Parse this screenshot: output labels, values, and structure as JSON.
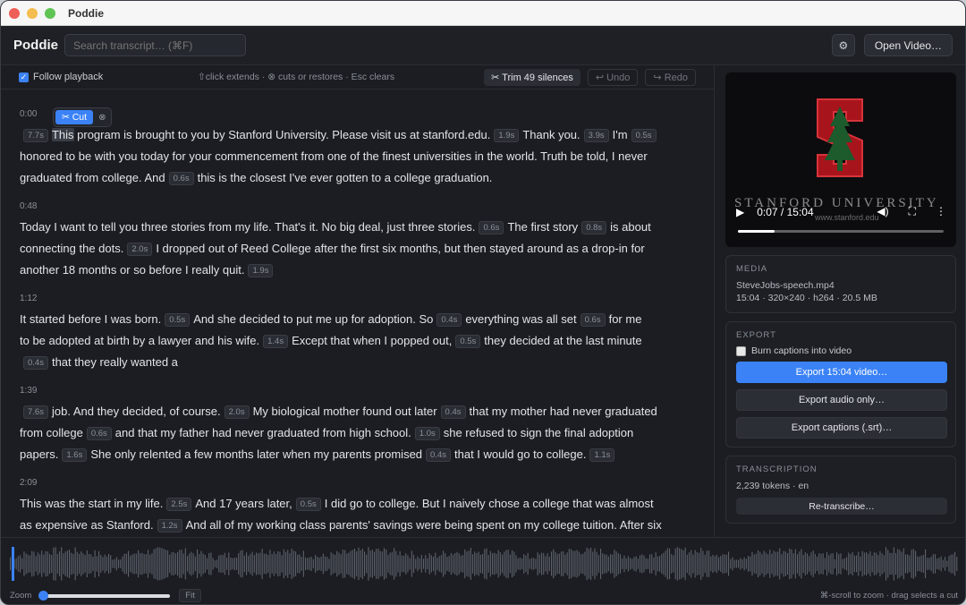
{
  "window": {
    "title": "Poddie"
  },
  "header": {
    "brand": "Poddie",
    "search_placeholder": "Search transcript… (⌘F)",
    "gear_glyph": "⚙",
    "open_video_label": "Open Video…"
  },
  "toolbar": {
    "follow_label": "Follow playback",
    "follow_checked": true,
    "hint": "⇧click extends · ⊗ cuts or restores · Esc clears",
    "trim_label": "✂ Trim 49 silences",
    "undo_label": "↩ Undo",
    "redo_label": "↪ Redo"
  },
  "cut_popup": {
    "cut_label": "✂ Cut",
    "restore_glyph": "⊗"
  },
  "transcript": [
    {
      "time": "0:00",
      "lines": [
        [
          {
            "s": "7.7s"
          },
          {
            "t": "This",
            "hl": true
          },
          {
            "t": " program is brought to you by Stanford University. Please visit us at stanford.edu."
          },
          {
            "s": "1.9s"
          },
          {
            "t": "Thank you."
          },
          {
            "s": "3.9s"
          },
          {
            "t": "I'm"
          },
          {
            "s": "0.5s"
          }
        ],
        [
          {
            "t": "honored to be with you today for your commencement from one of the finest universities in the world. Truth be told, I never"
          }
        ],
        [
          {
            "t": "graduated from college. And"
          },
          {
            "s": "0.6s"
          },
          {
            "t": "this is the closest I've ever gotten to a college graduation."
          }
        ]
      ]
    },
    {
      "time": "0:48",
      "lines": [
        [
          {
            "t": "Today I want to tell you three stories from my life. That's it. No big deal, just three stories."
          },
          {
            "s": "0.6s"
          },
          {
            "t": "The first story"
          },
          {
            "s": "0.8s"
          },
          {
            "t": "is about"
          }
        ],
        [
          {
            "t": "connecting the dots."
          },
          {
            "s": "2.0s"
          },
          {
            "t": "I dropped out of Reed College after the first six months, but then stayed around as a drop-in for"
          }
        ],
        [
          {
            "t": "another 18 months or so before I really quit."
          },
          {
            "s": "1.9s"
          }
        ]
      ]
    },
    {
      "time": "1:12",
      "lines": [
        [
          {
            "t": "It started before I was born."
          },
          {
            "s": "0.5s"
          },
          {
            "t": "And she decided to put me up for adoption. So"
          },
          {
            "s": "0.4s"
          },
          {
            "t": "everything was all set"
          },
          {
            "s": "0.6s"
          },
          {
            "t": "for me"
          }
        ],
        [
          {
            "t": "to be adopted at birth by a lawyer and his wife."
          },
          {
            "s": "1.4s"
          },
          {
            "t": "Except that when I popped out,"
          },
          {
            "s": "0.5s"
          },
          {
            "t": "they decided at the last minute"
          }
        ],
        [
          {
            "s": "0.4s"
          },
          {
            "t": "that they really wanted a"
          }
        ]
      ]
    },
    {
      "time": "1:39",
      "lines": [
        [
          {
            "s": "7.6s"
          },
          {
            "t": "job. And they decided, of course."
          },
          {
            "s": "2.0s"
          },
          {
            "t": "My biological mother found out later"
          },
          {
            "s": "0.4s"
          },
          {
            "t": "that my mother had never graduated"
          }
        ],
        [
          {
            "t": "from college"
          },
          {
            "s": "0.6s"
          },
          {
            "t": "and that my father had never graduated from high school."
          },
          {
            "s": "1.0s"
          },
          {
            "t": "she refused to sign the final adoption"
          }
        ],
        [
          {
            "t": "papers."
          },
          {
            "s": "1.6s"
          },
          {
            "t": "She only relented a few months later when my parents promised"
          },
          {
            "s": "0.4s"
          },
          {
            "t": "that I would go to college."
          },
          {
            "s": "1.1s"
          }
        ]
      ]
    },
    {
      "time": "2:09",
      "lines": [
        [
          {
            "t": "This was the start in my life."
          },
          {
            "s": "2.5s"
          },
          {
            "t": "And 17 years later,"
          },
          {
            "s": "0.5s"
          },
          {
            "t": "I did go to college. But I naively chose a college that was almost"
          }
        ],
        [
          {
            "t": "as expensive as Stanford."
          },
          {
            "s": "1.2s"
          },
          {
            "t": "And all of my working class parents' savings were being spent on my college tuition. After six"
          }
        ]
      ]
    }
  ],
  "video": {
    "title_text": "STANFORD UNIVERSITY",
    "url_text": "www.stanford.edu",
    "time": "0:07 / 15:04",
    "progress": 0.0077
  },
  "media": {
    "label": "MEDIA",
    "filename": "SteveJobs-speech.mp4",
    "details": "15:04 · 320×240 · h264 · 20.5 MB"
  },
  "export": {
    "label": "EXPORT",
    "burn_label": "Burn captions into video",
    "burn_checked": false,
    "video_btn": "Export 15:04 video…",
    "audio_btn": "Export audio only…",
    "captions_btn": "Export captions (.srt)…"
  },
  "transcription": {
    "label": "TRANSCRIPTION",
    "info": "2,239 tokens · en",
    "retranscribe_btn": "Re-transcribe…"
  },
  "timeline": {
    "zoom_label": "Zoom",
    "fit_label": "Fit",
    "hint": "⌘-scroll to zoom · drag selects a cut",
    "zoom_level": 0
  },
  "colors": {
    "accent": "#3b82f6",
    "background": "#1b1d22"
  }
}
